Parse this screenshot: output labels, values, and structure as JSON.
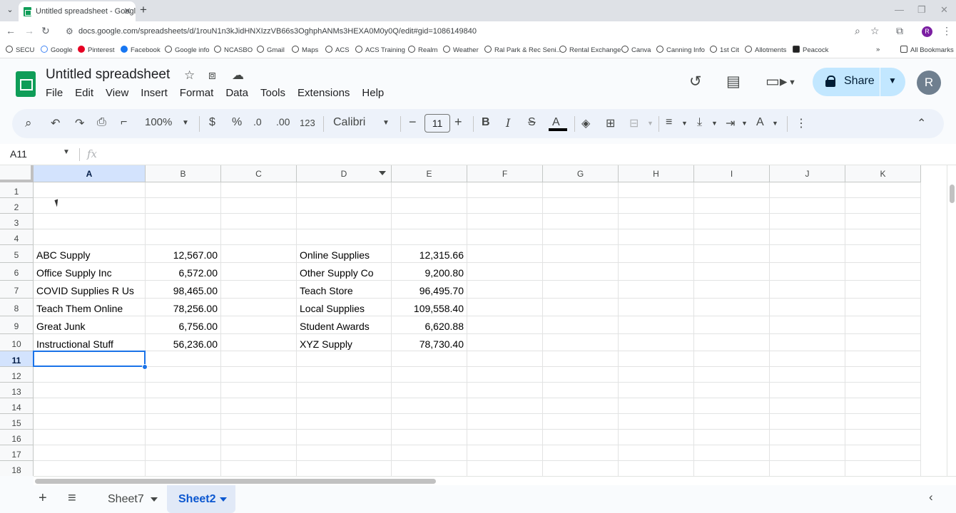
{
  "browser": {
    "tab_title": "Untitled spreadsheet - Google S",
    "url": "docs.google.com/spreadsheets/d/1rouN1n3kJidHNXIzzVB66s3OghphANMs3HEXA0M0y0Q/edit#gid=1086149840",
    "profile_initial": "R",
    "bookmarks": [
      "SECU",
      "Google",
      "Pinterest",
      "Facebook",
      "Google info",
      "NCASBO",
      "Gmail",
      "Maps",
      "ACS",
      "ACS Training",
      "Realm",
      "Weather",
      "Ral Park & Rec Seni...",
      "Rental Exchange",
      "Canva",
      "Canning Info",
      "1st Cit",
      "Allotments",
      "Peacock"
    ],
    "all_bookmarks": "All Bookmarks"
  },
  "app": {
    "title": "Untitled spreadsheet",
    "menu": [
      "File",
      "Edit",
      "View",
      "Insert",
      "Format",
      "Data",
      "Tools",
      "Extensions",
      "Help"
    ],
    "share_label": "Share",
    "avatar_initial": "R"
  },
  "toolbar": {
    "zoom": "100%",
    "currency": "$",
    "percent": "%",
    "dec_decrease": ".0",
    "dec_increase": ".00",
    "number_format": "123",
    "font": "Calibri",
    "font_size": "11"
  },
  "formula_bar": {
    "name_box": "A11",
    "fx": "fx"
  },
  "grid": {
    "columns": [
      "A",
      "B",
      "C",
      "D",
      "E",
      "F",
      "G",
      "H",
      "I",
      "J",
      "K"
    ],
    "rows": [
      "1",
      "2",
      "3",
      "4",
      "5",
      "6",
      "7",
      "8",
      "9",
      "10",
      "11",
      "12",
      "13",
      "14",
      "15",
      "16",
      "17",
      "18"
    ],
    "selected_column": "A",
    "selected_row": "11",
    "data_rows": [
      {
        "a": "ABC Supply",
        "b": "12,567.00",
        "d": "Online Supplies",
        "e": "12,315.66"
      },
      {
        "a": "Office Supply Inc",
        "b": "6,572.00",
        "d": "Other Supply Co",
        "e": "9,200.80"
      },
      {
        "a": "COVID Supplies R Us",
        "b": "98,465.00",
        "d": "Teach Store",
        "e": "96,495.70"
      },
      {
        "a": "Teach Them Online",
        "b": "78,256.00",
        "d": "Local Supplies",
        "e": "109,558.40"
      },
      {
        "a": "Great Junk",
        "b": "6,756.00",
        "d": "Student Awards",
        "e": "6,620.88"
      },
      {
        "a": "Instructional Stuff",
        "b": "56,236.00",
        "d": "XYZ Supply",
        "e": "78,730.40"
      }
    ]
  },
  "sheets": {
    "tabs": [
      "Sheet7",
      "Sheet2"
    ],
    "active": "Sheet2"
  },
  "colors": {
    "accent": "#1a73e8",
    "selection": "#d3e3fd",
    "share": "#c2e7ff",
    "sheets_green": "#0f9d58"
  }
}
